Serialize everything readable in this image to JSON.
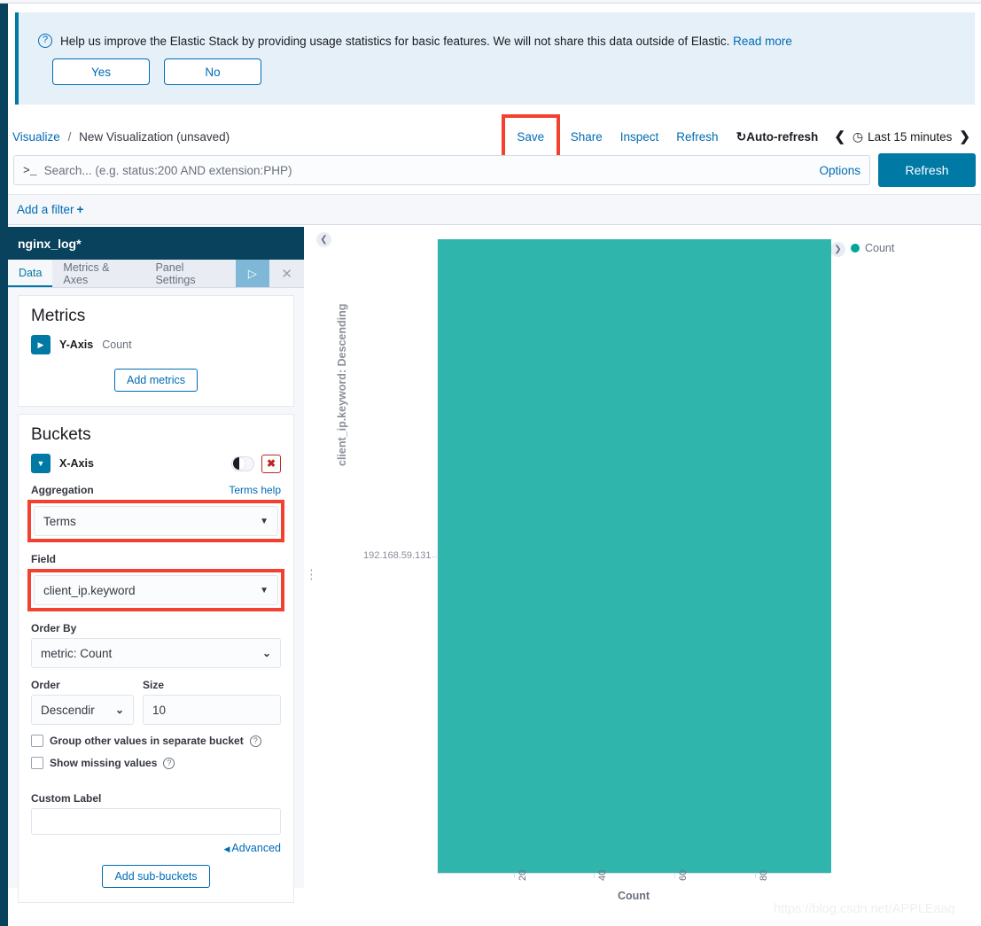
{
  "telemetry": {
    "message": "Help us improve the Elastic Stack by providing usage statistics for basic features. We will not share this data outside of Elastic.",
    "read_more": "Read more",
    "yes_label": "Yes",
    "no_label": "No",
    "icon": "question-circle-icon"
  },
  "breadcrumb": {
    "root": "Visualize",
    "separator": "/",
    "current": "New Visualization (unsaved)"
  },
  "topnav": {
    "save": "Save",
    "share": "Share",
    "inspect": "Inspect",
    "refresh": "Refresh",
    "auto_refresh": "Auto-refresh",
    "auto_refresh_icon": "↻",
    "prev_icon": "❮",
    "next_icon": "❯",
    "clock_icon": "◷",
    "time_range": "Last 15 minutes"
  },
  "query": {
    "prompt": ">_",
    "placeholder": "Search... (e.g. status:200 AND extension:PHP)",
    "value": "",
    "options": "Options",
    "refresh_button": "Refresh"
  },
  "filterbar": {
    "add_filter": "Add a filter",
    "plus": "+"
  },
  "editor": {
    "index_pattern": "nginx_log*",
    "tabs": [
      {
        "label": "Data",
        "active": true
      },
      {
        "label": "Metrics & Axes",
        "active": false
      },
      {
        "label": "Panel Settings",
        "active": false
      }
    ],
    "apply_icon": "▷",
    "close_icon": "✕",
    "metrics": {
      "title": "Metrics",
      "toggle_icon": "▶",
      "agg_name": "Y-Axis",
      "agg_value": "Count",
      "add_button": "Add metrics"
    },
    "buckets": {
      "title": "Buckets",
      "toggle_icon": "▼",
      "agg_name": "X-Axis",
      "toggle_icon_name": "visibility-toggle",
      "remove_icon": "✖",
      "aggregation_label": "Aggregation",
      "aggregation_help": "Terms help",
      "aggregation_value": "Terms",
      "field_label": "Field",
      "field_value": "client_ip.keyword",
      "order_by_label": "Order By",
      "order_by_value": "metric: Count",
      "order_label": "Order",
      "order_value": "Descendir",
      "size_label": "Size",
      "size_value": "10",
      "group_other_label": "Group other values in separate bucket",
      "show_missing_label": "Show missing values",
      "custom_label_label": "Custom Label",
      "custom_label_value": "",
      "advanced": "Advanced",
      "advanced_tri": "◀",
      "add_sub_buckets": "Add sub-buckets"
    }
  },
  "chart": {
    "collapse_left_icon": "❮",
    "collapse_right_icon": "❯",
    "legend_label": "Count",
    "legend_color": "#00a69b",
    "bar_color": "#2fb5ac"
  },
  "chart_data": {
    "type": "bar",
    "orientation": "horizontal",
    "title": "",
    "categories": [
      "192.168.59.131"
    ],
    "values": [
      95
    ],
    "series": [
      {
        "name": "Count",
        "values": [
          95
        ],
        "color": "#2fb5ac"
      }
    ],
    "xlabel": "Count",
    "ylabel": "client_ip.keyword: Descending",
    "xticks": [
      "20",
      "40",
      "60",
      "80"
    ],
    "xtick_values": [
      20,
      40,
      60,
      80
    ],
    "yticks": [
      "192.168.59.131"
    ],
    "xlim": [
      0,
      95
    ],
    "grid": false,
    "legend": {
      "position": "right",
      "entries": [
        "Count"
      ]
    }
  },
  "watermark": "https://blog.csdn.net/APPLEaaq"
}
